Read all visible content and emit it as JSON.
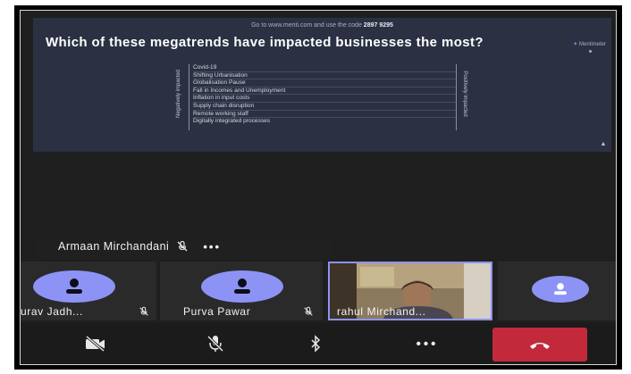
{
  "presentation": {
    "code_prefix": "Go to www.menti.com and use the code",
    "code": "2897 9295",
    "question": "Which of these megatrends have impacted businesses the most?",
    "brand": "Mentimeter",
    "left_axis": "Negatively impacted",
    "right_axis": "Positively impacted",
    "items": [
      "Covid-19",
      "Shifting Urbanisation",
      "Globalisation Pause",
      "Fall in Incomes and Unemployment",
      "Inflation in input costs",
      "Supply chain disruption",
      "Remote working staff",
      "Digitally integrated processes"
    ]
  },
  "presenter": {
    "name": "Armaan Mirchandani",
    "muted": true,
    "more_label": "•••"
  },
  "participants": [
    {
      "name": "urav Jadh...",
      "muted": true,
      "avatar": "person-icon"
    },
    {
      "name": "Purva Pawar",
      "muted": true,
      "avatar": "person-icon"
    },
    {
      "name": "rahul Mirchand...",
      "muted": false,
      "avatar": "video-feed"
    },
    {
      "name": "",
      "muted": false,
      "avatar": "person-icon"
    }
  ],
  "toolbar": {
    "camera": "video-off-icon",
    "mic": "mic-off-icon",
    "bluetooth": "bluetooth-icon",
    "more": "•••",
    "end_call": "hang-up-icon"
  },
  "colors": {
    "avatar": "#8c93f5",
    "end_call": "#c22a3b",
    "slide_bg": "#2b3142",
    "active_tile_border": "#8c93f5"
  }
}
